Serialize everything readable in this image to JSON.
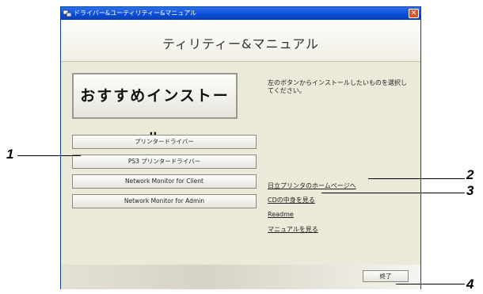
{
  "window": {
    "title": "ドライバー&ユーティリティー&マニュアル",
    "header_title": "ティリティー&マニュアル",
    "close_symbol": "✕"
  },
  "main_install_label": "おすすめインストール",
  "driver_buttons": [
    "プリンタードライバー",
    "PS3 プリンタードライバー",
    "Network Monitor for Client",
    "Network Monitor for Admin"
  ],
  "info_text": "左のボタンからインストールしたいものを選択してください。",
  "links": [
    "日立プリンタのホームページへ",
    "CDの中身を見る",
    "Readme",
    "マニュアルを見る"
  ],
  "exit_label": "終了",
  "callouts": [
    "1",
    "2",
    "3",
    "4"
  ]
}
